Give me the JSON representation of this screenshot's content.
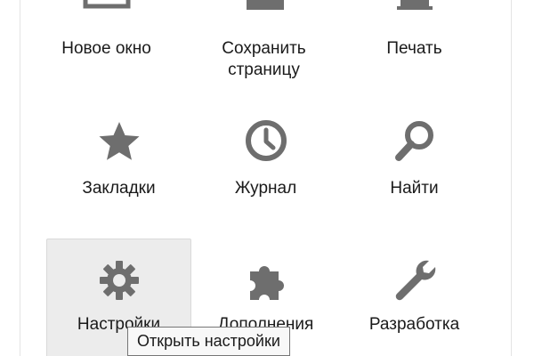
{
  "menu": {
    "items": [
      {
        "key": "new-window",
        "label": "Новое окно",
        "icon": "new-window-icon"
      },
      {
        "key": "save-page",
        "label": "Сохранить\nстраницу",
        "icon": "save-icon"
      },
      {
        "key": "print",
        "label": "Печать",
        "icon": "printer-icon"
      },
      {
        "key": "bookmarks",
        "label": "Закладки",
        "icon": "star-icon"
      },
      {
        "key": "history",
        "label": "Журнал",
        "icon": "clock-icon"
      },
      {
        "key": "find",
        "label": "Найти",
        "icon": "magnifier-icon"
      },
      {
        "key": "options",
        "label": "Настройки",
        "icon": "gear-icon",
        "hovered": true
      },
      {
        "key": "addons",
        "label": "Дополнения",
        "icon": "puzzle-icon"
      },
      {
        "key": "developer",
        "label": "Разработка",
        "icon": "wrench-icon"
      }
    ]
  },
  "tooltip": {
    "text": "Открыть настройки"
  },
  "colors": {
    "icon": "#6e6e6e",
    "hover_background": "#ececec",
    "tooltip_border": "#767676"
  }
}
